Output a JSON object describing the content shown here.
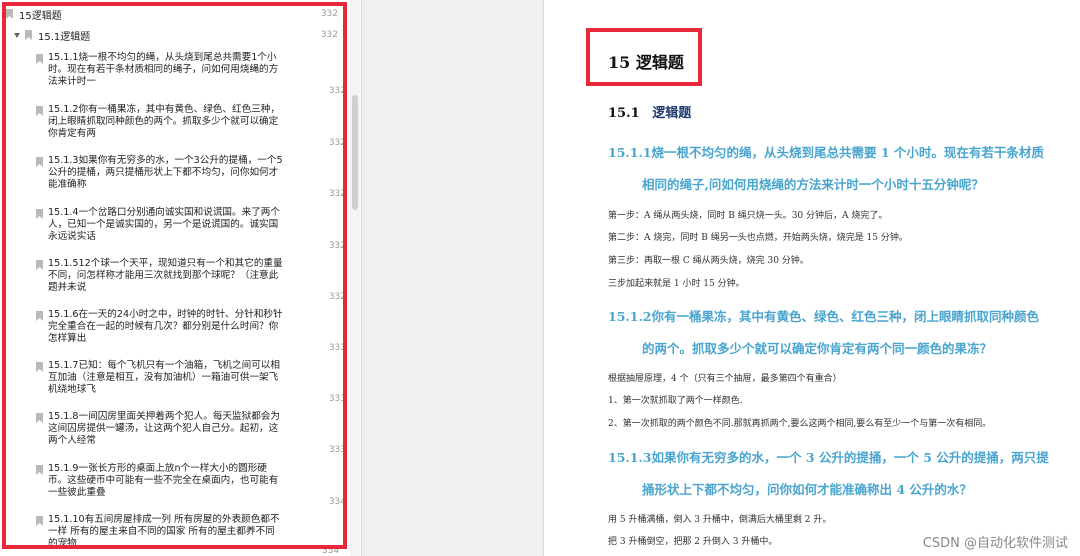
{
  "outline": {
    "top_item": {
      "label": "15逻辑题",
      "page": "332"
    },
    "section_item": {
      "label": "15.1逻辑题",
      "page": "332"
    },
    "items": [
      {
        "text": "15.1.1烧一根不均匀的绳，从头烧到尾总共需要1个小时。现在有若干条材质相同的绳子，问如何用烧绳的方法来计时一",
        "page": "332"
      },
      {
        "text": "15.1.2你有一桶果冻，其中有黄色、绿色、红色三种，闭上眼睛抓取同种颜色的两个。抓取多少个就可以确定你肯定有两",
        "page": "332"
      },
      {
        "text": "15.1.3如果你有无穷多的水，一个3公升的提桶，一个5公升的提桶，两只提桶形状上下都不均匀，问你如何才能准确称",
        "page": "332"
      },
      {
        "text": "15.1.4一个岔路口分别通向诚实国和说谎国。来了两个人，已知一个是诚实国的，另一个是说谎国的。诚实国永远说实话",
        "page": "332"
      },
      {
        "text": "15.1.512个球一个天平，现知道只有一个和其它的重量不同，问怎样称才能用三次就找到那个球呢？（注意此题并未说",
        "page": "332"
      },
      {
        "text": "15.1.6在一天的24小时之中，时钟的时针、分针和秒针完全重合在一起的时候有几次？都分别是什么时间？你怎样算出",
        "page": "333"
      },
      {
        "text": "15.1.7已知：每个飞机只有一个油箱，飞机之间可以相互加油（注意是相互，没有加油机）一箱油可供一架飞机绕地球飞",
        "page": "333"
      },
      {
        "text": "15.1.8一间囚房里面关押着两个犯人。每天监狱都会为这间囚房提供一罐汤，让这两个犯人自己分。起初，这两个人经常",
        "page": "333"
      },
      {
        "text": "15.1.9一张长方形的桌面上放n个一样大小的圆形硬币。这些硬币中可能有一些不完全在桌面内，也可能有一些彼此重叠",
        "page": "334"
      },
      {
        "text": "15.1.10有五间房屋排成一列 所有房屋的外表颜色都不一样 所有的屋主来自不同的国家 所有的屋主都养不同的宠物",
        "page": "334"
      }
    ]
  },
  "document": {
    "chapter_title": "15 逻辑题",
    "section": {
      "number": "15.1",
      "title": "逻辑题"
    },
    "q1": {
      "title_line1": "15.1.1烧一根不均匀的绳，从头烧到尾总共需要 1 个小时。现在有若干条材质",
      "title_line2": "相同的绳子,问如何用烧绳的方法来计时一个小时十五分钟呢？",
      "answers": [
        "第一步：A 绳从两头烧，同时 B 绳只烧一头。30 分钟后，A 烧完了。",
        "第二步：A 烧完，同时 B 绳另一头也点燃，开始两头烧，烧完是 15 分钟。",
        "第三步：再取一根 C 绳从两头烧，烧完 30 分钟。",
        "三步加起来就是 1 小时 15 分钟。"
      ]
    },
    "q2": {
      "title_line1": "15.1.2你有一桶果冻，其中有黄色、绿色、红色三种，闭上眼睛抓取同种颜色",
      "title_line2": "的两个。抓取多少个就可以确定你肯定有两个同一颜色的果冻？",
      "answers": [
        "根据抽屉原理，4 个（只有三个抽屉，最多第四个有重合）",
        "1、第一次就抓取了两个一样颜色.",
        "2、第一次抓取的两个颜色不同.那就再抓两个,要么这两个相同,要么有至少一个与第一次有相同。"
      ]
    },
    "q3": {
      "title_line1": "15.1.3如果你有无穷多的水，一个 3 公升的提捅，一个 5 公升的提捅，两只提",
      "title_line2": "捅形状上下都不均匀，问你如何才能准确称出 4 公升的水？",
      "answers": [
        "用 5 升桶满桶，倒入 3 升桶中，倒满后大桶里剩 2 升。",
        "把 3 升桶倒空，把那 2 升倒入 3 升桶中。"
      ]
    },
    "watermark": "CSDN @自动化软件测试"
  },
  "scroll": {
    "bottom_page": "334"
  },
  "colors": {
    "highlight": "#e8293a",
    "question": "#4aa5cf",
    "section": "#1f3b70"
  }
}
